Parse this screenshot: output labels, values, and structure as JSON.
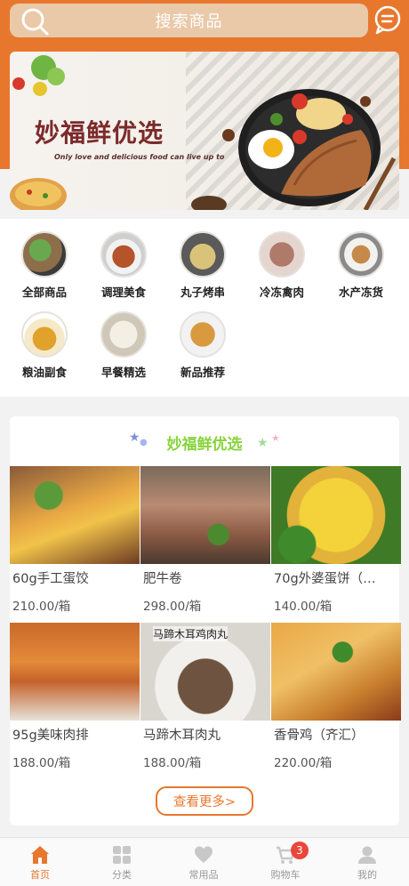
{
  "search": {
    "placeholder": "搜索商品"
  },
  "banner": {
    "title": "妙福鲜优选",
    "subtitle": "Only love and delicious food can live up to"
  },
  "categories": [
    {
      "label": "全部商品"
    },
    {
      "label": "调理美食"
    },
    {
      "label": "丸子烤串"
    },
    {
      "label": "冷冻禽肉"
    },
    {
      "label": "水产冻货"
    },
    {
      "label": "粮油副食"
    },
    {
      "label": "早餐精选"
    },
    {
      "label": "新品推荐"
    }
  ],
  "section": {
    "title": "妙福鲜优选"
  },
  "products": [
    {
      "name": "60g手工蛋饺",
      "price": "210.00/箱"
    },
    {
      "name": "肥牛卷",
      "price": "298.00/箱"
    },
    {
      "name": "70g外婆蛋饼（…",
      "price": "140.00/箱"
    },
    {
      "name": "95g美味肉排",
      "price": "188.00/箱"
    },
    {
      "name": "马蹄木耳肉丸",
      "price": "188.00/箱",
      "image_caption": "马蹄木耳鸡肉丸"
    },
    {
      "name": "香骨鸡（齐汇）",
      "price": "220.00/箱"
    }
  ],
  "more_button": {
    "label": "查看更多>"
  },
  "tabbar": {
    "items": [
      {
        "label": "首页",
        "icon": "home-icon",
        "active": true
      },
      {
        "label": "分类",
        "icon": "grid-icon"
      },
      {
        "label": "常用品",
        "icon": "heart-icon"
      },
      {
        "label": "购物车",
        "icon": "cart-icon",
        "badge": "3"
      },
      {
        "label": "我的",
        "icon": "user-icon"
      }
    ]
  },
  "colors": {
    "accent": "#e8772e",
    "section_title": "#86d43b",
    "badge": "#e9473a"
  }
}
